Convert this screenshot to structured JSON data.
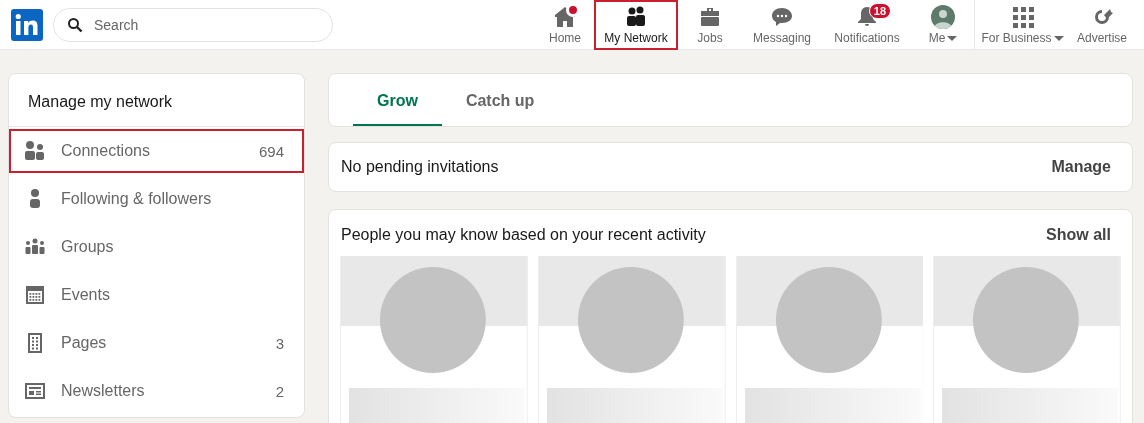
{
  "header": {
    "search": {
      "placeholder": "Search"
    },
    "nav": [
      {
        "kind": "home",
        "label": "Home",
        "selected": false,
        "highlighted": false,
        "dot": true
      },
      {
        "kind": "network",
        "label": "My Network",
        "selected": true,
        "highlighted": true
      },
      {
        "kind": "jobs",
        "label": "Jobs",
        "selected": false,
        "highlighted": false
      },
      {
        "kind": "messaging",
        "label": "Messaging",
        "selected": false,
        "highlighted": false
      },
      {
        "kind": "notifications",
        "label": "Notifications",
        "selected": false,
        "highlighted": false,
        "badge": "18"
      },
      {
        "kind": "me",
        "label": "Me",
        "selected": false,
        "highlighted": false,
        "dropdown": true
      },
      {
        "kind": "business",
        "label": "For Business",
        "selected": false,
        "highlighted": false,
        "dropdown": true
      },
      {
        "kind": "advertise",
        "label": "Advertise",
        "selected": false,
        "highlighted": false
      }
    ]
  },
  "sidebar": {
    "title": "Manage my network",
    "items": [
      {
        "kind": "connections",
        "label": "Connections",
        "count": "694",
        "highlighted": true
      },
      {
        "kind": "following",
        "label": "Following & followers",
        "highlighted": false
      },
      {
        "kind": "groups",
        "label": "Groups",
        "highlighted": false
      },
      {
        "kind": "events",
        "label": "Events",
        "highlighted": false
      },
      {
        "kind": "pages",
        "label": "Pages",
        "count": "3",
        "highlighted": false
      },
      {
        "kind": "newsletters",
        "label": "Newsletters",
        "count": "2",
        "highlighted": false
      }
    ]
  },
  "tabs": [
    {
      "label": "Grow",
      "selected": true
    },
    {
      "label": "Catch up",
      "selected": false
    }
  ],
  "invitations": {
    "text": "No pending invitations",
    "action": "Manage"
  },
  "suggestions": {
    "title": "People you may know based on your recent activity",
    "action": "Show all"
  }
}
